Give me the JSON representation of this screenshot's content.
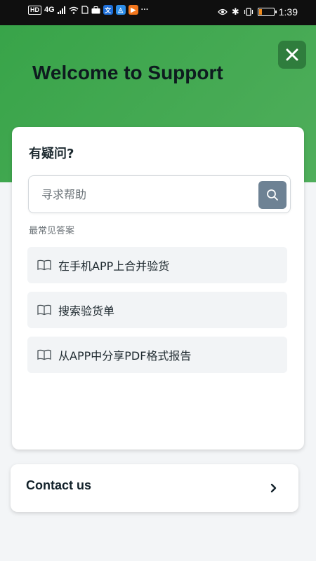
{
  "status_bar": {
    "hd": "HD",
    "network": "4G",
    "time": "1:39",
    "battery_level": 0.18,
    "battery_color": "#f08a1c"
  },
  "header": {
    "title": "Welcome to Support",
    "close_icon": "close-icon",
    "bg_color": "#4fae5b"
  },
  "card": {
    "title": "有疑问?",
    "search": {
      "placeholder": "寻求帮助",
      "value": "",
      "icon": "search-icon",
      "button_color": "#6e8294"
    },
    "section_label": "最常见答案",
    "faq_items": [
      {
        "label": "在手机APP上合并验货",
        "icon": "book-icon"
      },
      {
        "label": "搜索验货单",
        "icon": "book-icon"
      },
      {
        "label": "从APP中分享PDF格式报告",
        "icon": "book-icon"
      }
    ]
  },
  "contact": {
    "label": "Contact us",
    "icon": "chevron-right-icon"
  }
}
